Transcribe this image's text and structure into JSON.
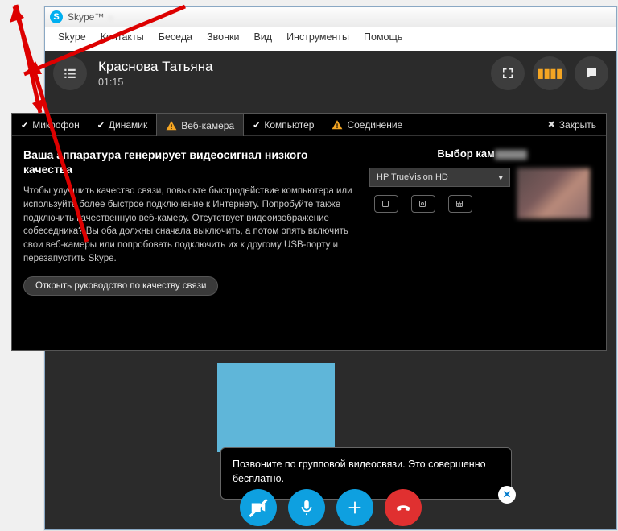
{
  "titlebar": {
    "app": "Skype™"
  },
  "menu": {
    "items": [
      "Skype",
      "Контакты",
      "Беседа",
      "Звонки",
      "Вид",
      "Инструменты",
      "Помощь"
    ]
  },
  "call": {
    "contact_name": "Краснова Татьяна",
    "duration": "01:15"
  },
  "tooltip": {
    "text": "Позвоните по групповой видеосвязи. Это совершенно бесплатно."
  },
  "diagnostics": {
    "tabs": {
      "mic": "Микрофон",
      "spk": "Динамик",
      "cam": "Веб-камера",
      "cpu": "Компьютер",
      "net": "Соединение"
    },
    "close": "Закрыть",
    "title": "Ваша аппаратура генерирует видеосигнал низкого качества",
    "text": "Чтобы улучшить качество связи, повысьте быстродействие компьютера или используйте более быстрое подключение к Интернету. Попробуйте также подключить качественную веб-камеру. Отсутствует видеоизображение собеседника? Вы оба должны сначала выключить, а потом опять включить свои веб-камеры или попробовать подключить их к другому USB-порту и перезапустить Skype.",
    "guide_btn": "Открыть руководство по качеству связи",
    "cam_section_title": "Выбор кам",
    "cam_selected": "HP TrueVision HD"
  }
}
